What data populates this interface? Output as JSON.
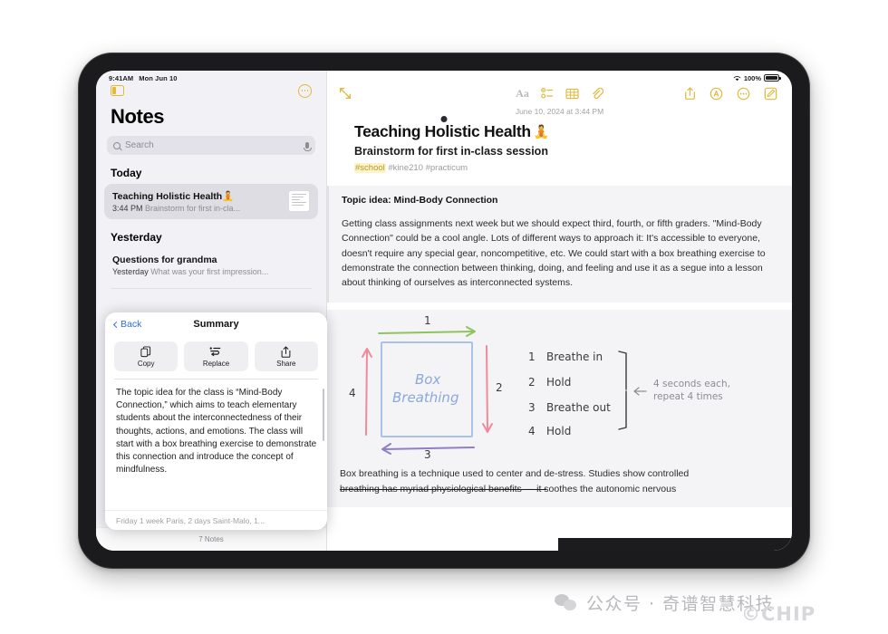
{
  "status_bar": {
    "time": "9:41AM",
    "date": "Mon Jun 10",
    "battery_percent": "100%",
    "wifi_icon": "wifi-icon",
    "battery_icon": "battery-icon"
  },
  "sidebar": {
    "toggle_icon": "sidebar-toggle-icon",
    "more_icon": "more-circle-icon",
    "title": "Notes",
    "search": {
      "placeholder": "Search",
      "search_icon": "search-icon",
      "mic_icon": "microphone-icon"
    },
    "sections": [
      {
        "header": "Today",
        "notes": [
          {
            "title": "Teaching Holistic Health",
            "emoji": "🧘",
            "time": "3:44 PM",
            "preview": "Brainstorm for first in-cla...",
            "selected": true,
            "thumbnail": "note-thumbnail"
          }
        ]
      },
      {
        "header": "Yesterday",
        "notes": [
          {
            "title": "Questions for grandma",
            "emoji": "",
            "time": "Yesterday",
            "preview": "What was your first impression...",
            "selected": false,
            "thumbnail": ""
          }
        ]
      }
    ],
    "footer_count": "7 Notes"
  },
  "summary_panel": {
    "back_label": "Back",
    "title": "Summary",
    "actions": [
      {
        "label": "Copy",
        "icon": "copy-icon"
      },
      {
        "label": "Replace",
        "icon": "replace-icon"
      },
      {
        "label": "Share",
        "icon": "share-icon"
      }
    ],
    "body": "The topic idea for the class is “Mind-Body Connection,” which aims to teach elementary students about the interconnectedness of their thoughts, actions, and emotions. The class will start with a box breathing exercise to demonstrate this connection and introduce the concept of mindfulness.",
    "footer": "Friday  1 week Paris, 2 days Saint-Malo, 1..."
  },
  "editor": {
    "toolbar": {
      "collapse_icon": "collapse-arrows-icon",
      "center_icons": [
        {
          "name": "format-aa-icon",
          "label": "Aa",
          "state": "disabled"
        },
        {
          "name": "checklist-icon",
          "label": "",
          "state": "active"
        },
        {
          "name": "table-icon",
          "label": "",
          "state": "active"
        },
        {
          "name": "attachment-icon",
          "label": "",
          "state": "active"
        }
      ],
      "right_icons": [
        {
          "name": "share-icon"
        },
        {
          "name": "markup-icon"
        },
        {
          "name": "more-icon"
        },
        {
          "name": "compose-icon"
        }
      ]
    },
    "date": "June 10, 2024 at 3:44 PM",
    "title": "Teaching Holistic Health",
    "title_emoji": "🧘",
    "subtitle": "Brainstorm for first in-class session",
    "tags": [
      {
        "text": "#school",
        "highlighted": true
      },
      {
        "text": "#kine210",
        "highlighted": false
      },
      {
        "text": "#practicum",
        "highlighted": false
      }
    ],
    "block_heading": "Topic idea: Mind-Body Connection",
    "block_paragraph": "Getting class assignments next week but we should expect third, fourth, or fifth graders. \"Mind-Body Connection\" could be a cool angle. Lots of different ways to approach it: It's accessible to everyone, doesn't require any special gear, noncompetitive, etc. We could start with a box breathing exercise to demonstrate the connection between thinking, doing, and feeling and use it as a segue into a lesson about thinking of ourselves as interconnected systems.",
    "sketch": {
      "box_label_line1": "Box",
      "box_label_line2": "Breathing",
      "arrow_numbers": [
        "1",
        "2",
        "3",
        "4"
      ],
      "steps": [
        {
          "num": "1",
          "text": "Breathe in"
        },
        {
          "num": "2",
          "text": "Hold"
        },
        {
          "num": "3",
          "text": "Breathe out"
        },
        {
          "num": "4",
          "text": "Hold"
        }
      ],
      "annotation_line1": "4 seconds each,",
      "annotation_line2": "repeat 4 times",
      "colors": {
        "arrow_top": "#8cc45f",
        "arrow_right": "#f08a9b",
        "arrow_bottom": "#8f7ec8",
        "arrow_left": "#f08a9b",
        "box": "#a8c2ea",
        "label": "#8aa8dd",
        "ink": "#3a3a3c"
      }
    },
    "closing_paragraph_line1": "Box breathing is a technique used to center and de-stress. Studies show controlled",
    "closing_paragraph_line2_hidden": "breathing has myriad physiological ben",
    "closing_paragraph_line2_visible": "efits — it soothes the autonomic nervous"
  },
  "watermark": {
    "text": "公众号 · 奇谱智慧科技",
    "icon": "wechat-icon",
    "chip": "©CHIP"
  },
  "colors": {
    "accent_yellow": "#e2b93b",
    "sidebar_bg": "#f2f1f6",
    "selected_row": "#dedde4",
    "link_blue": "#2f6fd0",
    "block_bg": "#f4f4f6"
  }
}
